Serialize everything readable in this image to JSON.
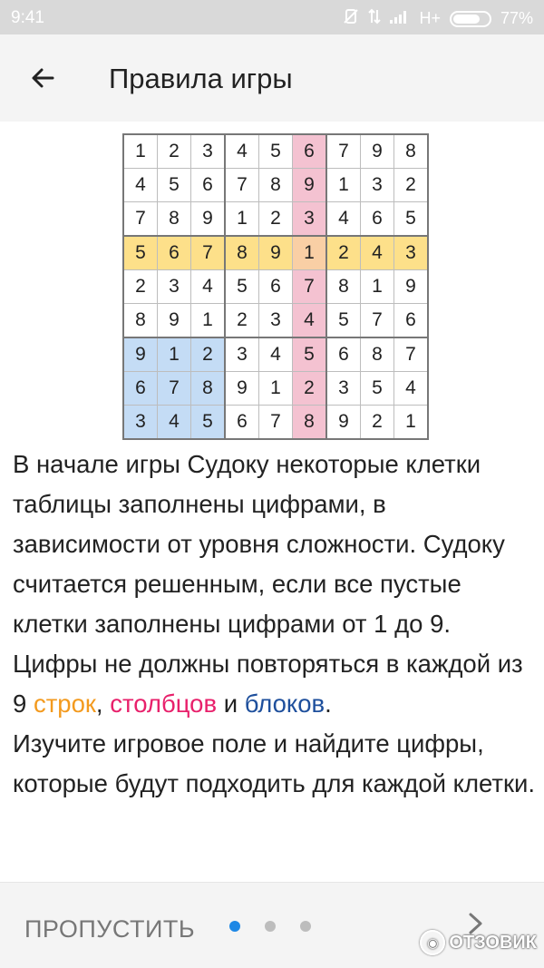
{
  "status_bar": {
    "time": "9:41",
    "network": "H+",
    "battery": "77%",
    "battery_level": 0.77
  },
  "app_bar": {
    "title": "Правила игры"
  },
  "sudoku": {
    "rows": [
      [
        1,
        2,
        3,
        4,
        5,
        6,
        7,
        9,
        8
      ],
      [
        4,
        5,
        6,
        7,
        8,
        9,
        1,
        3,
        2
      ],
      [
        7,
        8,
        9,
        1,
        2,
        3,
        4,
        6,
        5
      ],
      [
        5,
        6,
        7,
        8,
        9,
        1,
        2,
        4,
        3
      ],
      [
        2,
        3,
        4,
        5,
        6,
        7,
        8,
        1,
        9
      ],
      [
        8,
        9,
        1,
        2,
        3,
        4,
        5,
        7,
        6
      ],
      [
        9,
        1,
        2,
        3,
        4,
        5,
        6,
        8,
        7
      ],
      [
        6,
        7,
        8,
        9,
        1,
        2,
        3,
        5,
        4
      ],
      [
        3,
        4,
        5,
        6,
        7,
        8,
        9,
        2,
        1
      ]
    ],
    "highlight_row": 3,
    "highlight_column": 5,
    "highlight_block": [
      2,
      0
    ],
    "colors": {
      "row": "#fde08a",
      "column": "#f4c2d1",
      "intersection": "#f9cfa5",
      "block": "#c4dcf5"
    }
  },
  "rules": {
    "p1_a": "В начале игры Судоку некоторые клетки таблицы заполнены цифрами, в зависимости от уровня сложности. Судоку считается решенным, если все пустые клетки заполнены цифрами от 1 до 9. Цифры не должны повторяться в каждой из 9 ",
    "rows_word": "строк",
    "sep": ", ",
    "columns_word": "столбцов",
    "and": " и ",
    "blocks_word": "блоков",
    "end": ".",
    "p2": "Изучите игровое поле и найдите цифры, которые будут подходить для каждой клетки.",
    "colors": {
      "rows": "#f39a1e",
      "columns": "#e8206b",
      "blocks": "#1e4f9c"
    }
  },
  "bottom_nav": {
    "skip_label": "ПРОПУСТИТЬ",
    "page_count": 3,
    "active_page": 0,
    "next_icon": "chevron-right-icon",
    "accent": "#1e88e5"
  },
  "watermark": {
    "text": "ОТЗОВИК"
  }
}
